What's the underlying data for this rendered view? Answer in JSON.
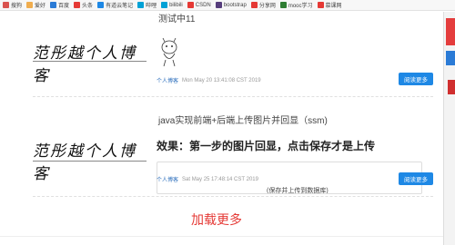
{
  "bookmarks": [
    {
      "label": "搜狗",
      "color": "#d9534f"
    },
    {
      "label": "爱好",
      "color": "#f0ad4e"
    },
    {
      "label": "百度",
      "color": "#2b7bd6"
    },
    {
      "label": "头条",
      "color": "#e53935"
    },
    {
      "label": "有道云笔记",
      "color": "#1e88e5"
    },
    {
      "label": "哔哩",
      "color": "#00a1d6"
    },
    {
      "label": "bilibili",
      "color": "#00a1d6"
    },
    {
      "label": "CSDN",
      "color": "#e53935"
    },
    {
      "label": "bootstrap",
      "color": "#563d7c"
    },
    {
      "label": "分享网",
      "color": "#e53935"
    },
    {
      "label": "mooc学习",
      "color": "#2e7d32"
    },
    {
      "label": "慕课网",
      "color": "#e53935"
    }
  ],
  "posts": [
    {
      "logo_text": "范彤越个人博客",
      "title": "测试中11",
      "meta_author": "个人博客",
      "meta_time": "Mon May 20 13:41:08 CST 2019",
      "read_more": "阅读更多"
    },
    {
      "logo_text": "范彤越个人博客",
      "title": "java实现前端+后端上传图片并回显（ssm)",
      "subtitle": "效果：第一步的图片回显，点击保存才是上传",
      "excerpt": "(保存并上传到数据库)",
      "meta_author": "个人博客",
      "meta_time": "Sat May 25 17:48:14 CST 2019",
      "read_more": "阅读更多"
    }
  ],
  "load_more": "加载更多",
  "colors": {
    "accent_blue": "#1e88e5",
    "load_more_red": "#e53935"
  }
}
